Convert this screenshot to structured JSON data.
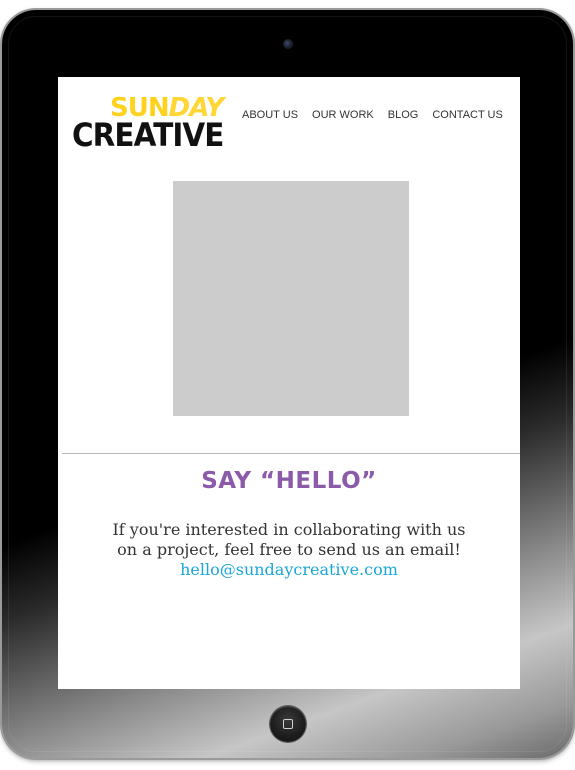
{
  "brand": {
    "logo_top_part1": "SUN",
    "logo_top_part2": "DAY",
    "logo_bottom": "CREATIVE",
    "colors": {
      "logo_yellow": "#ffd21f",
      "logo_black": "#111111",
      "title_purple": "#8b5aa8",
      "link_cyan": "#1aa7d6",
      "image_placeholder": "#cccccc"
    }
  },
  "nav": {
    "items": [
      {
        "label": "ABOUT US"
      },
      {
        "label": "OUR WORK"
      },
      {
        "label": "BLOG"
      },
      {
        "label": "CONTACT US"
      }
    ]
  },
  "contact": {
    "title": "SAY “HELLO”",
    "line1": "If you're interested in collaborating with us",
    "line2": "on a project, feel free to send us an email!",
    "email": "hello@sundaycreative.com"
  },
  "device": {
    "icons": {
      "camera": "camera-icon",
      "home": "home-button-icon"
    }
  }
}
